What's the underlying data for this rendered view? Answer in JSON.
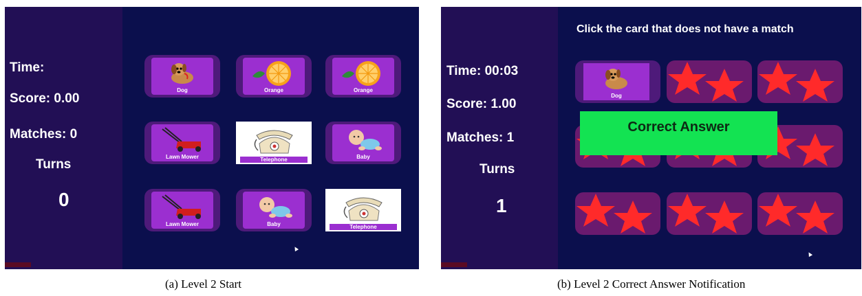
{
  "panel_a": {
    "stats": {
      "time": "Time:",
      "score": "Score: 0.00",
      "matches": "Matches: 0",
      "turns_label": "Turns",
      "turns_value": "0"
    },
    "cards": [
      {
        "label": "Dog",
        "icon": "dog-icon"
      },
      {
        "label": "Orange",
        "icon": "orange-icon"
      },
      {
        "label": "Orange",
        "icon": "orange-icon"
      },
      {
        "label": "Lawn Mower",
        "icon": "lawn-mower-icon"
      },
      {
        "label": "Telephone",
        "icon": "telephone-icon"
      },
      {
        "label": "Baby",
        "icon": "baby-icon"
      },
      {
        "label": "Lawn Mower",
        "icon": "lawn-mower-icon"
      },
      {
        "label": "Baby",
        "icon": "baby-icon"
      },
      {
        "label": "Telephone",
        "icon": "telephone-icon"
      }
    ],
    "caption": "(a) Level 2 Start"
  },
  "panel_b": {
    "instruction": "Click the card that does not have a match",
    "stats": {
      "time": "Time: 00:03",
      "score": "Score: 1.00",
      "matches": "Matches: 1",
      "turns_label": "Turns",
      "turns_value": "1"
    },
    "revealed_card": {
      "label": "Dog",
      "icon": "dog-icon"
    },
    "hidden_card_icon": "star-icon",
    "notification": "Correct Answer",
    "caption": "(b) Level 2 Correct Answer Notification"
  },
  "colors": {
    "background": "#0b0f4d",
    "sidebar": "#220f55",
    "card": "#9b2fd0",
    "card_back": "#6a1a6e",
    "star": "#ff2a2a",
    "notification": "#13e352"
  }
}
